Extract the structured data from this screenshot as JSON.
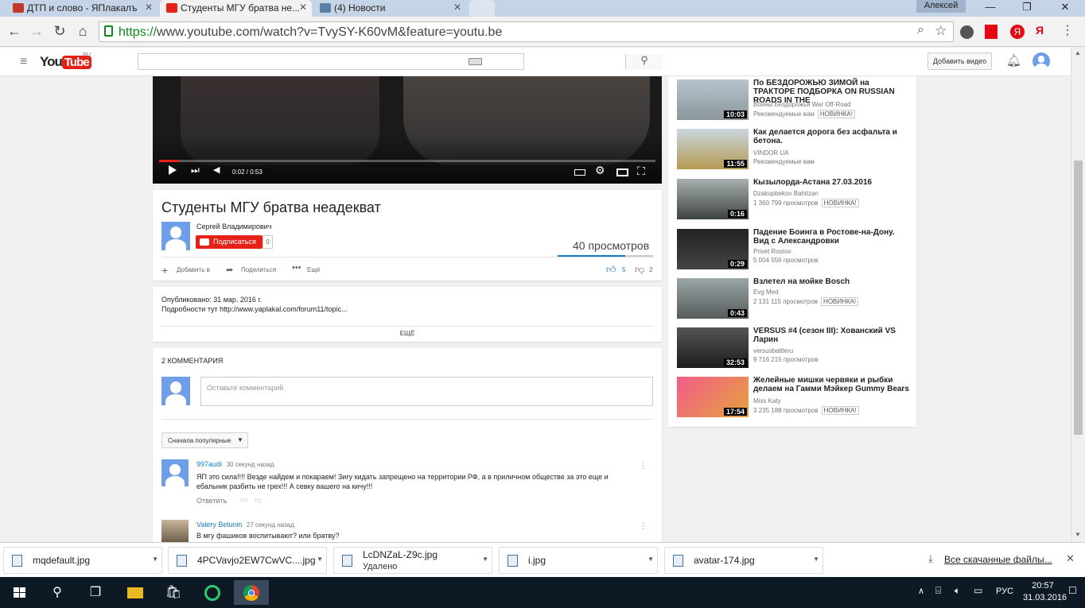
{
  "browser": {
    "tabs": [
      {
        "title": "ДТП и слово - ЯПлакалъ"
      },
      {
        "title": "Студенты МГУ братва не..."
      },
      {
        "title": "(4) Новости"
      }
    ],
    "user_name": "Алексей",
    "url_scheme": "https://",
    "url_rest": "www.youtube.com/watch?v=TvySY-K60vM&feature=youtu.be"
  },
  "youtube": {
    "logo_text": "You",
    "logo_tube": "Tube",
    "region": "RU",
    "add_video_label": "Добавить видео"
  },
  "player": {
    "time": "0:02 / 0:53",
    "progress": 0.04
  },
  "video": {
    "title": "Студенты МГУ братва неадекват",
    "channel": "Сергей Владимирович",
    "subscribe_label": "Подписаться",
    "subscriber_count": "0",
    "views": "40 просмотров",
    "add_to_label": "Добавить в",
    "share_label": "Поделиться",
    "more_label": "Ещё",
    "likes": "5",
    "dislikes": "2"
  },
  "description": {
    "published": "Опубликовано: 31 мар. 2016 г.",
    "text": "Подробности тут http://www.yaplakal.com/forum11/topic...",
    "more_label": "ЕЩЁ"
  },
  "comments": {
    "header": "2 КОММЕНТАРИЯ",
    "input_placeholder": "Оставьте комментарий",
    "sort_label": "Сначала популярные",
    "items": [
      {
        "author": "997audi",
        "time": "30 секунд назад",
        "text": "ЯП это сила!!!! Везде найдем и покараем! Зигу кидать запрещено на территории РФ, а в приличном обществе за это еще и ебальник разбить не грех!!! А севку вашего на кичу!!!",
        "reply_label": "Ответить"
      },
      {
        "author": "Valery Belunin",
        "time": "27 секунд назад",
        "text": "В мгу фашиков воспитывают? или братву?"
      }
    ]
  },
  "recommendations": [
    {
      "title": "По БЕЗДОРОЖЬЮ ЗИМОЙ на ТРАКТОРЕ ПОДБОРКА ON RUSSIAN ROADS IN THE",
      "author": "Войны Бездорожья War Off-Road",
      "meta": "Рекомендуемые вам",
      "badge": "НОВИНКА!",
      "duration": "10:03"
    },
    {
      "title": "Как делается дорога без асфальта и бетона.",
      "author": "VINDOR UA",
      "meta": "Рекомендуемые вам",
      "badge": "",
      "duration": "11:55"
    },
    {
      "title": "Кызылорда-Астана 27.03.2016",
      "author": "Dzakupbekov Bahitzan",
      "meta": "1 360 799 просмотров",
      "badge": "НОВИНКА!",
      "duration": "0:16"
    },
    {
      "title": "Падение Боинга в Ростове-на-Дону. Вид с Александровки",
      "author": "Privet Rostov",
      "meta": "5 004 556 просмотров",
      "badge": "",
      "duration": "0:29"
    },
    {
      "title": "Взлетел на мойке Bosch",
      "author": "Evg Med",
      "meta": "2 131 115 просмотров",
      "badge": "НОВИНКА!",
      "duration": "0:43"
    },
    {
      "title": "VERSUS #4 (сезон III): Хованский VS Ларин",
      "author": "versusbattleru",
      "meta": "9 716 215 просмотров",
      "badge": "НОВИНКА!",
      "duration": "32:53"
    },
    {
      "title": "Желейные мишки червяки и рыбки делаем на Гамми Мэйкер Gummy Bears",
      "author": "Miss Katy",
      "meta": "3 235 188 просмотров",
      "badge": "НОВИНКА!",
      "duration": "17:54"
    }
  ],
  "downloads": {
    "items": [
      {
        "name": "mqdefault.jpg",
        "sub": ""
      },
      {
        "name": "4PCVavjo2EW7CwVC....jpg",
        "sub": ""
      },
      {
        "name": "LcDNZaL-Z9c.jpg",
        "sub": "Удалено"
      },
      {
        "name": "i.jpg",
        "sub": ""
      },
      {
        "name": "avatar-174.jpg",
        "sub": ""
      }
    ],
    "all_label": "Все скачанные файлы..."
  },
  "taskbar": {
    "lang": "РУС",
    "time": "20:57",
    "date": "31.03.2016"
  },
  "colors": {
    "youtube_red": "#e62117",
    "link_blue": "#167ac6",
    "taskbar": "#0d1a26"
  }
}
